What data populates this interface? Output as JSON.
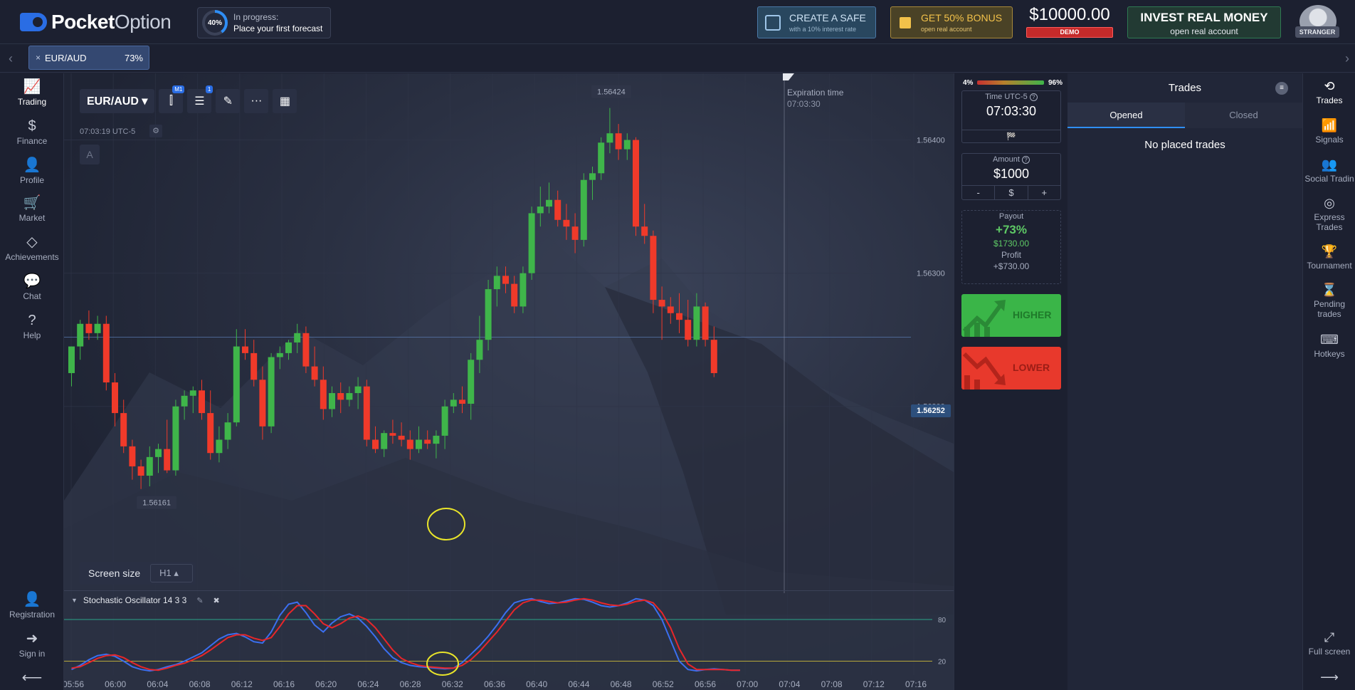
{
  "header": {
    "logo_bold": "Pocket",
    "logo_light": "Option",
    "progress": {
      "percent_label": "40%",
      "percent": 0.4,
      "line1": "In progress:",
      "line2": "Place your first forecast"
    },
    "safe": {
      "title": "CREATE A SAFE",
      "subtitle": "with a 10% interest rate"
    },
    "bonus": {
      "title": "GET 50% BONUS",
      "subtitle": "open real account"
    },
    "balance": {
      "amount": "$10000.00",
      "mode": "DEMO"
    },
    "invest": {
      "title": "INVEST REAL MONEY",
      "subtitle": "open real account"
    },
    "user_tag": "STRANGER"
  },
  "tabs": {
    "left_arrow": "‹",
    "right_arrow": "›",
    "asset": {
      "close": "×",
      "name": "EUR/AUD",
      "payout": "73%"
    }
  },
  "left_nav": {
    "items": [
      {
        "icon": "trading-icon",
        "glyph": "📈",
        "label": "Trading"
      },
      {
        "icon": "dollar-icon",
        "glyph": "$",
        "label": "Finance"
      },
      {
        "icon": "user-icon",
        "glyph": "👤",
        "label": "Profile"
      },
      {
        "icon": "cart-icon",
        "glyph": "🛒",
        "label": "Market"
      },
      {
        "icon": "diamond-icon",
        "glyph": "◇",
        "label": "Achievements"
      },
      {
        "icon": "chat-icon",
        "glyph": "💬",
        "label": "Chat"
      },
      {
        "icon": "help-icon",
        "glyph": "?",
        "label": "Help"
      }
    ],
    "bottom": [
      {
        "icon": "user-plus-icon",
        "glyph": "👤",
        "label": "Registration"
      },
      {
        "icon": "sign-in-icon",
        "glyph": "➜",
        "label": "Sign in"
      }
    ],
    "collapse_glyph": "⟵"
  },
  "chart": {
    "asset_label": "EUR/AUD ▾",
    "timeframe_badge": "M1",
    "indicator_badge": "1",
    "time_label": "07:03:19  UTC-5",
    "gear_glyph": "⚙",
    "a_label": "A",
    "expiration_label": "Expiration time",
    "expiration_value": "07:03:30",
    "high_label": "1.56424",
    "low_label": "1.56161",
    "current_price": "1.56252",
    "screen_size_label": "Screen size",
    "screen_size_value": "H1 ▴",
    "indicator_name": "Stochastic Oscillator  14 3 3",
    "price_ticks": [
      "1.56400",
      "1.56300",
      "1.56200"
    ],
    "osc_levels": [
      "80",
      "20"
    ],
    "time_ticks": [
      "05:56",
      "06:00",
      "06:04",
      "06:08",
      "06:12",
      "06:16",
      "06:20",
      "06:24",
      "06:28",
      "06:32",
      "06:36",
      "06:40",
      "06:44",
      "06:48",
      "06:52",
      "06:56",
      "07:00",
      "07:04",
      "07:08",
      "07:12",
      "07:16",
      "07"
    ]
  },
  "chart_data": {
    "type": "candlestick",
    "ylim": [
      1.5614,
      1.5645
    ],
    "levels": [
      80,
      20
    ],
    "up_color": "#3fb54a",
    "down_color": "#f03a2a",
    "candles": [
      [
        1.56225,
        1.56245,
        1.56215,
        1.56245
      ],
      [
        1.56245,
        1.56265,
        1.56235,
        1.56262
      ],
      [
        1.56262,
        1.56272,
        1.5625,
        1.56255
      ],
      [
        1.56255,
        1.56268,
        1.5625,
        1.56262
      ],
      [
        1.56262,
        1.56268,
        1.56212,
        1.56218
      ],
      [
        1.56218,
        1.56225,
        1.56185,
        1.56195
      ],
      [
        1.56195,
        1.56205,
        1.56165,
        1.5617
      ],
      [
        1.5617,
        1.56175,
        1.56145,
        1.56155
      ],
      [
        1.56155,
        1.5616,
        1.56138,
        1.56148
      ],
      [
        1.56148,
        1.5617,
        1.5614,
        1.56162
      ],
      [
        1.56162,
        1.56172,
        1.5615,
        1.56168
      ],
      [
        1.56168,
        1.5619,
        1.5615,
        1.56152
      ],
      [
        1.56152,
        1.56205,
        1.56148,
        1.562
      ],
      [
        1.562,
        1.56212,
        1.5619,
        1.56208
      ],
      [
        1.56208,
        1.56215,
        1.56195,
        1.56212
      ],
      [
        1.56212,
        1.5622,
        1.5619,
        1.56195
      ],
      [
        1.56195,
        1.56212,
        1.5616,
        1.56165
      ],
      [
        1.56165,
        1.56185,
        1.56158,
        1.56175
      ],
      [
        1.56175,
        1.56195,
        1.56168,
        1.56188
      ],
      [
        1.56188,
        1.56258,
        1.56185,
        1.56245
      ],
      [
        1.56245,
        1.56258,
        1.56235,
        1.5624
      ],
      [
        1.5624,
        1.5625,
        1.56215,
        1.5622
      ],
      [
        1.5622,
        1.5623,
        1.56175,
        1.56185
      ],
      [
        1.56185,
        1.5624,
        1.5618,
        1.56237
      ],
      [
        1.56237,
        1.56245,
        1.56228,
        1.5624
      ],
      [
        1.5624,
        1.5625,
        1.56235,
        1.56248
      ],
      [
        1.56248,
        1.56262,
        1.5624,
        1.56255
      ],
      [
        1.56255,
        1.5626,
        1.56225,
        1.5623
      ],
      [
        1.5623,
        1.56245,
        1.56215,
        1.5622
      ],
      [
        1.5622,
        1.5623,
        1.5619,
        1.56198
      ],
      [
        1.56198,
        1.56215,
        1.56192,
        1.5621
      ],
      [
        1.5621,
        1.56218,
        1.56195,
        1.56205
      ],
      [
        1.56205,
        1.56215,
        1.562,
        1.5621
      ],
      [
        1.5621,
        1.56222,
        1.56198,
        1.56215
      ],
      [
        1.56215,
        1.5622,
        1.5617,
        1.56175
      ],
      [
        1.56175,
        1.56185,
        1.56165,
        1.56168
      ],
      [
        1.56168,
        1.56182,
        1.56162,
        1.5618
      ],
      [
        1.5618,
        1.5619,
        1.56172,
        1.56178
      ],
      [
        1.56178,
        1.56188,
        1.5617,
        1.56175
      ],
      [
        1.56175,
        1.56182,
        1.5616,
        1.56168
      ],
      [
        1.56168,
        1.56185,
        1.56165,
        1.56175
      ],
      [
        1.56175,
        1.56182,
        1.56168,
        1.56172
      ],
      [
        1.56172,
        1.56182,
        1.56161,
        1.56178
      ],
      [
        1.56178,
        1.56205,
        1.56168,
        1.562
      ],
      [
        1.562,
        1.5621,
        1.56195,
        1.56205
      ],
      [
        1.56205,
        1.56215,
        1.56195,
        1.56202
      ],
      [
        1.56202,
        1.5624,
        1.5619,
        1.56235
      ],
      [
        1.56235,
        1.56268,
        1.56225,
        1.5625
      ],
      [
        1.5625,
        1.56295,
        1.56242,
        1.56288
      ],
      [
        1.56288,
        1.56305,
        1.56275,
        1.56298
      ],
      [
        1.56298,
        1.56305,
        1.56285,
        1.56292
      ],
      [
        1.56292,
        1.56298,
        1.5627,
        1.56275
      ],
      [
        1.56275,
        1.56305,
        1.5627,
        1.563
      ],
      [
        1.563,
        1.5635,
        1.56295,
        1.56345
      ],
      [
        1.56345,
        1.56365,
        1.56335,
        1.5635
      ],
      [
        1.5635,
        1.56368,
        1.56345,
        1.56355
      ],
      [
        1.56355,
        1.56362,
        1.56335,
        1.5634
      ],
      [
        1.5634,
        1.56352,
        1.56325,
        1.56335
      ],
      [
        1.56335,
        1.56345,
        1.56315,
        1.56325
      ],
      [
        1.56325,
        1.56375,
        1.5632,
        1.5637
      ],
      [
        1.5637,
        1.5638,
        1.56355,
        1.56375
      ],
      [
        1.56375,
        1.56402,
        1.5637,
        1.56398
      ],
      [
        1.56398,
        1.56424,
        1.5639,
        1.56405
      ],
      [
        1.56405,
        1.56412,
        1.56385,
        1.56393
      ],
      [
        1.56393,
        1.56405,
        1.56385,
        1.564
      ],
      [
        1.564,
        1.56402,
        1.56328,
        1.56335
      ],
      [
        1.56335,
        1.56352,
        1.56322,
        1.56328
      ],
      [
        1.56328,
        1.56332,
        1.5627,
        1.5628
      ],
      [
        1.5628,
        1.5629,
        1.5625,
        1.56275
      ],
      [
        1.56275,
        1.56282,
        1.56262,
        1.5627
      ],
      [
        1.5627,
        1.56285,
        1.56255,
        1.56265
      ],
      [
        1.56265,
        1.5628,
        1.56245,
        1.5625
      ],
      [
        1.5625,
        1.56285,
        1.56245,
        1.56275
      ],
      [
        1.56275,
        1.56278,
        1.56245,
        1.5625
      ],
      [
        1.5625,
        1.5626,
        1.56222,
        1.56225
      ]
    ],
    "stoch_k": [
      8,
      14,
      22,
      28,
      30,
      27,
      20,
      12,
      8,
      6,
      8,
      12,
      15,
      20,
      26,
      32,
      42,
      52,
      58,
      60,
      55,
      48,
      46,
      62,
      86,
      102,
      105,
      90,
      72,
      62,
      75,
      84,
      88,
      82,
      70,
      55,
      38,
      25,
      18,
      14,
      12,
      11,
      10,
      9,
      10,
      18,
      30,
      42,
      56,
      72,
      90,
      104,
      108,
      110,
      106,
      103,
      104,
      107,
      110,
      109,
      105,
      100,
      98,
      100,
      104,
      110,
      108,
      100,
      80,
      50,
      20,
      8,
      6,
      8,
      9,
      8,
      7,
      7
    ],
    "stoch_d": [
      10,
      12,
      18,
      24,
      28,
      29,
      25,
      18,
      12,
      8,
      7,
      10,
      14,
      17,
      22,
      28,
      36,
      45,
      54,
      58,
      58,
      53,
      50,
      54,
      70,
      88,
      100,
      100,
      88,
      74,
      68,
      74,
      82,
      85,
      80,
      68,
      52,
      36,
      24,
      18,
      14,
      12,
      11,
      10,
      10,
      14,
      22,
      34,
      48,
      62,
      78,
      94,
      104,
      108,
      108,
      106,
      104,
      105,
      108,
      110,
      108,
      104,
      101,
      100,
      102,
      106,
      108,
      104,
      90,
      68,
      38,
      16,
      8,
      8,
      8,
      8,
      7,
      7
    ]
  },
  "trade_panel": {
    "sentiment_low": "4%",
    "sentiment_high": "96%",
    "sentiment_up_fraction": 0.96,
    "time_caption": "Time UTC-5",
    "time_value": "07:03:30",
    "flag_glyph": "🏁",
    "amount_caption": "Amount",
    "amount_value": "$1000",
    "minus": "-",
    "currency": "$",
    "plus": "+",
    "payout_caption": "Payout",
    "payout_pct": "+73%",
    "payout_value": "$1730.00",
    "profit_caption": "Profit",
    "profit_value": "+$730.00",
    "higher_label": "HIGHER",
    "lower_label": "LOWER"
  },
  "trades": {
    "title": "Trades",
    "tab_opened": "Opened",
    "tab_closed": "Closed",
    "empty_text": "No placed trades",
    "menu_glyph": "≡"
  },
  "right_nav": {
    "items": [
      {
        "icon": "trades-icon",
        "glyph": "⟲",
        "label": "Trades"
      },
      {
        "icon": "signals-icon",
        "glyph": "📶",
        "label": "Signals"
      },
      {
        "icon": "social-trading-icon",
        "glyph": "👥",
        "label": "Social Tradin"
      },
      {
        "icon": "express-trades-icon",
        "glyph": "◎",
        "label": "Express Trades"
      },
      {
        "icon": "trophy-icon",
        "glyph": "🏆",
        "label": "Tournament"
      },
      {
        "icon": "hourglass-icon",
        "glyph": "⌛",
        "label": "Pending trades"
      },
      {
        "icon": "keyboard-icon",
        "glyph": "⌨",
        "label": "Hotkeys"
      }
    ],
    "fullscreen": {
      "icon": "fullscreen-icon",
      "glyph": "⤢",
      "label": "Full screen"
    },
    "expand_glyph": "⟶"
  }
}
